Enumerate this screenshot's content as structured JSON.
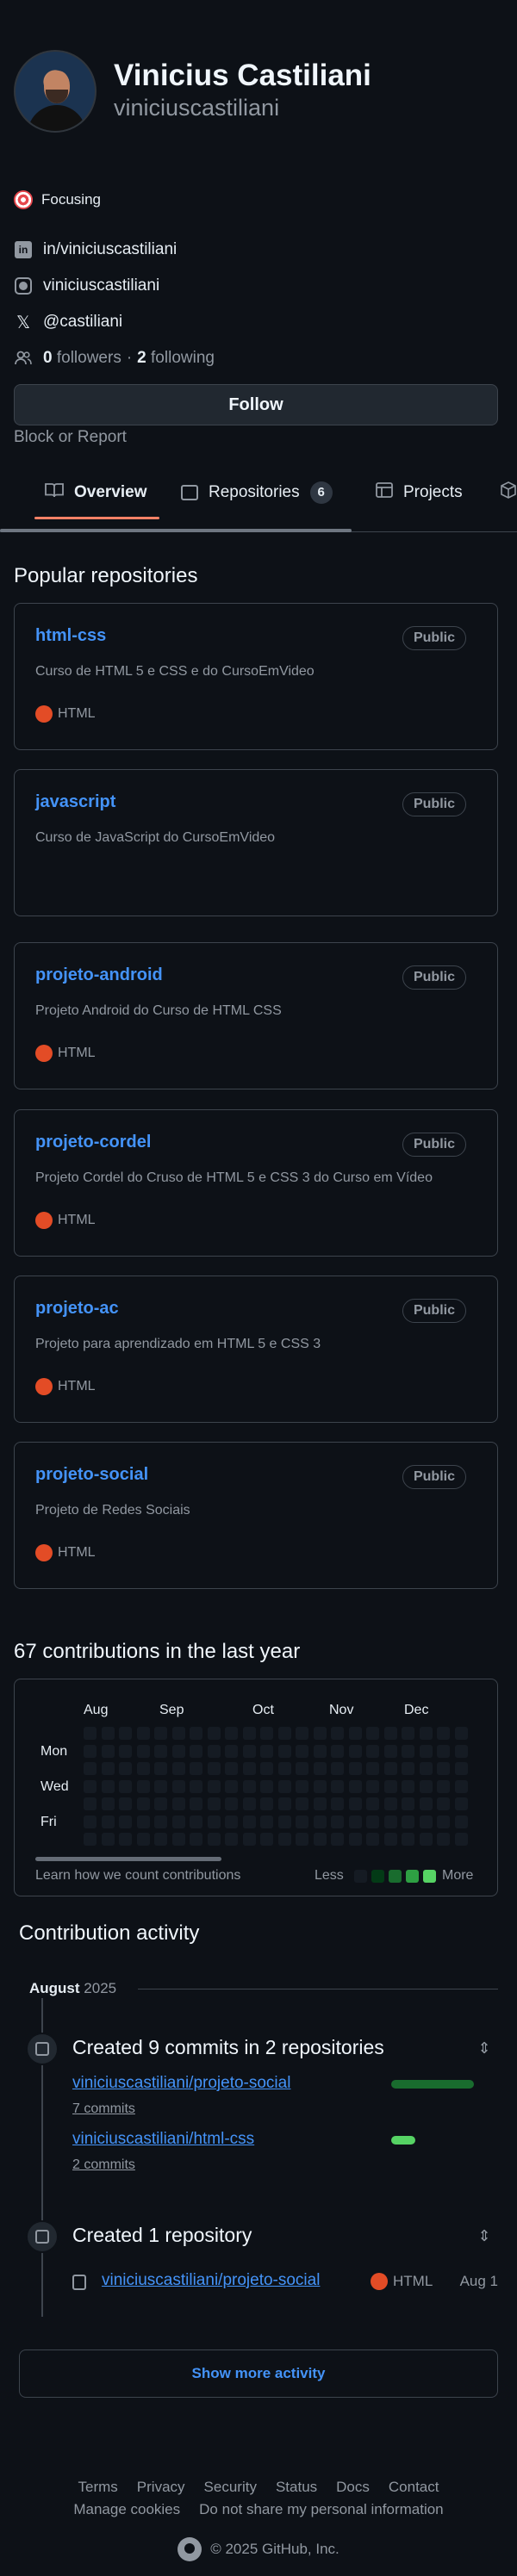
{
  "profile": {
    "name": "Vinicius Castiliani",
    "login": "viniciuscastiliani",
    "status": "Focusing",
    "linkedin": "in/viniciuscastiliani",
    "instagram": "viniciuscastiliani",
    "x": "@castiliani",
    "followers_count": "0",
    "followers_label": "followers",
    "separator": "·",
    "following_count": "2",
    "following_label": "following",
    "follow_button": "Follow",
    "block_report": "Block or Report"
  },
  "tabs": [
    {
      "label": "Overview"
    },
    {
      "label": "Repositories",
      "count": "6"
    },
    {
      "label": "Projects"
    }
  ],
  "popular": {
    "title": "Popular repositories",
    "repos": [
      {
        "name": "html-css",
        "badge": "Public",
        "description": "Curso de HTML 5 e CSS e do CursoEmVideo",
        "language": "HTML"
      },
      {
        "name": "javascript",
        "badge": "Public",
        "description": "Curso de JavaScript do CursoEmVideo",
        "language": ""
      },
      {
        "name": "projeto-android",
        "badge": "Public",
        "description": "Projeto Android do Curso de HTML CSS",
        "language": "HTML"
      },
      {
        "name": "projeto-cordel",
        "badge": "Public",
        "description": "Projeto Cordel do Cruso de HTML 5 e CSS 3 do Curso em Vídeo",
        "language": "HTML"
      },
      {
        "name": "projeto-ac",
        "badge": "Public",
        "description": "Projeto para aprendizado em HTML 5 e CSS 3",
        "language": "HTML"
      },
      {
        "name": "projeto-social",
        "badge": "Public",
        "description": "Projeto de Redes Sociais",
        "language": "HTML"
      }
    ]
  },
  "contributions": {
    "title": "67 contributions in the last year",
    "months": [
      "Aug",
      "Sep",
      "Oct",
      "Nov",
      "Dec"
    ],
    "days": [
      "Mon",
      "Wed",
      "Fri"
    ],
    "learn": "Learn how we count contributions",
    "less": "Less",
    "more": "More",
    "legend_colors": [
      "#151b23",
      "#033a16",
      "#196c2e",
      "#2ea043",
      "#56d364"
    ]
  },
  "activity": {
    "title": "Contribution activity",
    "month": "August",
    "year": "2025",
    "commits_heading": "Created 9 commits in 2 repositories",
    "commit_repos": [
      {
        "repo": "viniciuscastiliani/projeto-social",
        "count": "7 commits",
        "share": 1.0,
        "color": "#196c2e"
      },
      {
        "repo": "viniciuscastiliani/html-css",
        "count": "2 commits",
        "share": 0.29,
        "color": "#56d364"
      }
    ],
    "created_heading": "Created 1 repository",
    "created_repo": "viniciuscastiliani/projeto-social",
    "created_lang": "HTML",
    "created_date": "Aug 1",
    "show_more": "Show more activity"
  },
  "footer": {
    "links_row1": [
      "Terms",
      "Privacy",
      "Security",
      "Status",
      "Docs",
      "Contact"
    ],
    "links_row2": [
      "Manage cookies",
      "Do not share my personal information"
    ],
    "copyright": "© 2025 GitHub, Inc."
  },
  "colors": {
    "accent": "#4493f8",
    "html_lang": "#e34c26",
    "underline": "#f78166"
  },
  "icons": [
    "focus-target-icon",
    "linkedin-icon",
    "instagram-icon",
    "x-icon",
    "people-icon",
    "book-icon",
    "repo-icon",
    "table-icon",
    "package-icon",
    "repo-push-icon",
    "fold-icon",
    "github-logo-icon"
  ]
}
